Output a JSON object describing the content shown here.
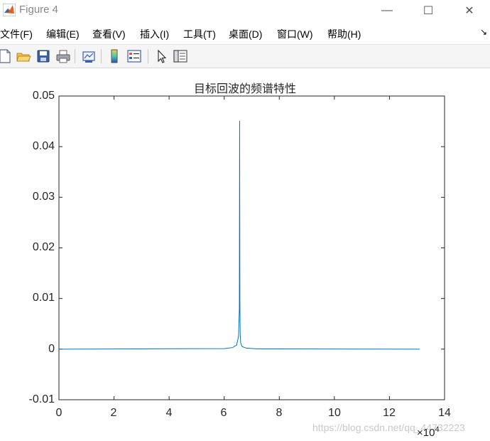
{
  "window": {
    "title": "Figure 4",
    "minimize_glyph": "—",
    "maximize_glyph": "☐",
    "close_glyph": "✕"
  },
  "menu": [
    {
      "label": "文件(F)"
    },
    {
      "label": "编辑(E)"
    },
    {
      "label": "查看(V)"
    },
    {
      "label": "插入(I)"
    },
    {
      "label": "工具(T)"
    },
    {
      "label": "桌面(D)"
    },
    {
      "label": "窗口(W)"
    },
    {
      "label": "帮助(H)"
    }
  ],
  "menu_arrow": "↘",
  "toolbar_icons": [
    "new-file-icon",
    "open-folder-icon",
    "save-icon",
    "print-icon",
    "link-plot-icon",
    "colorbar-icon",
    "legend-icon",
    "pointer-icon",
    "property-inspector-icon"
  ],
  "watermark": "https://blog.csdn.net/qq_44732223",
  "chart_data": {
    "type": "line",
    "title": "目标回波的频谱特性",
    "xlabel": "",
    "ylabel": "",
    "xlim": [
      0,
      14
    ],
    "ylim": [
      -0.01,
      0.05
    ],
    "x_ticks": [
      "0",
      "2",
      "4",
      "6",
      "8",
      "10",
      "12",
      "14"
    ],
    "y_ticks": [
      "0.05",
      "0.04",
      "0.03",
      "0.02",
      "0.01",
      "0",
      "-0.01"
    ],
    "x_exponent_base": "×10",
    "x_exponent_power": "4",
    "grid": false,
    "legend": false,
    "series_color": "#0072bd",
    "series": [
      {
        "x": [
          0,
          6.0,
          6.3,
          6.45,
          6.52,
          6.55,
          6.56,
          6.57,
          6.58,
          6.6,
          6.65,
          6.8,
          7.2,
          13.1
        ],
        "y": [
          0,
          0.0001,
          0.0003,
          0.0008,
          0.0025,
          0.008,
          0.0451,
          0.0095,
          0.003,
          0.0012,
          0.0005,
          0.0002,
          5e-05,
          0
        ]
      }
    ]
  }
}
